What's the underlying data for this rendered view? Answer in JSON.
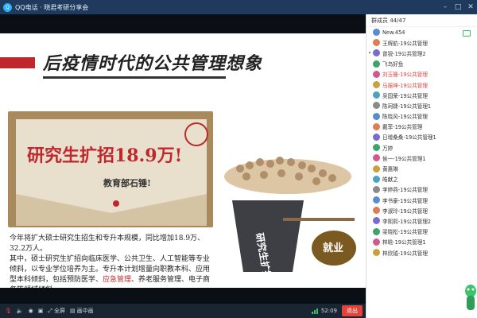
{
  "window": {
    "title": "QQ电话 · 晓君考研分享会"
  },
  "slide": {
    "title": "后疫情时代的公共管理想象",
    "photo_headline": "研究生扩招18.9万!",
    "photo_sub": "教育部石锤!",
    "paragraph1": "今年将扩大硕士研究生招生和专升本规模，同比增加18.9万、32.2万人。",
    "paragraph2_a": "其中，硕士研究生扩招向临床医学、公共卫生、人工智能等专业倾斜，以专业学位培养为主。专升本计划增量向职教本科、应用型本科倾斜，包括预防医学、",
    "paragraph2_hl": "应急管理",
    "paragraph2_b": "、养老服务管理、电子商务等领域倾斜。",
    "illustration_label_left": "研究生扩招",
    "illustration_label_right": "就业"
  },
  "toolbar": {
    "fullscreen_label": "全屏",
    "pip_label": "画中画",
    "time": "52:09",
    "exit_label": "退出"
  },
  "sidebar": {
    "header": "群成员 44/47",
    "members": [
      {
        "name": "New.454",
        "red": false,
        "expand": false
      },
      {
        "name": "王辉航-19公共管理",
        "red": false,
        "expand": false
      },
      {
        "name": "曾锐-19公共管理2",
        "red": false,
        "expand": true
      },
      {
        "name": "飞鸟好鱼",
        "red": false,
        "expand": false
      },
      {
        "name": "刘玉珊-19公共管理",
        "red": true,
        "expand": false
      },
      {
        "name": "马振坤-19公共管理",
        "red": true,
        "expand": false
      },
      {
        "name": "吴国荣-19公共管理",
        "red": false,
        "expand": false
      },
      {
        "name": "陈珂婕-19公共管理1",
        "red": false,
        "expand": false
      },
      {
        "name": "陈晓风-19公共管理",
        "red": false,
        "expand": false
      },
      {
        "name": "戴菲-19公共管理",
        "red": false,
        "expand": false
      },
      {
        "name": "日增桑桑-19公共管理1",
        "red": false,
        "expand": false
      },
      {
        "name": "万婷",
        "red": false,
        "expand": false
      },
      {
        "name": "侯一-19公共管理1",
        "red": false,
        "expand": false
      },
      {
        "name": "黄惠琳",
        "red": false,
        "expand": false
      },
      {
        "name": "皓献之",
        "red": false,
        "expand": false
      },
      {
        "name": "李婷燕-19公共管理",
        "red": false,
        "expand": false
      },
      {
        "name": "李书豪-19公共管理",
        "red": false,
        "expand": false
      },
      {
        "name": "李淑玲-19公共管理",
        "red": false,
        "expand": false
      },
      {
        "name": "李熙熙-19公共管理2",
        "red": false,
        "expand": false
      },
      {
        "name": "梁晓松-19公共管理",
        "red": false,
        "expand": false
      },
      {
        "name": "林晗-19公共管理1",
        "red": false,
        "expand": false
      },
      {
        "name": "林欣钺-19公共管理",
        "red": false,
        "expand": false
      }
    ]
  },
  "colors": {
    "accent": "#c0272d",
    "exit": "#e0443c",
    "titlebar": "#1f3a5c"
  }
}
